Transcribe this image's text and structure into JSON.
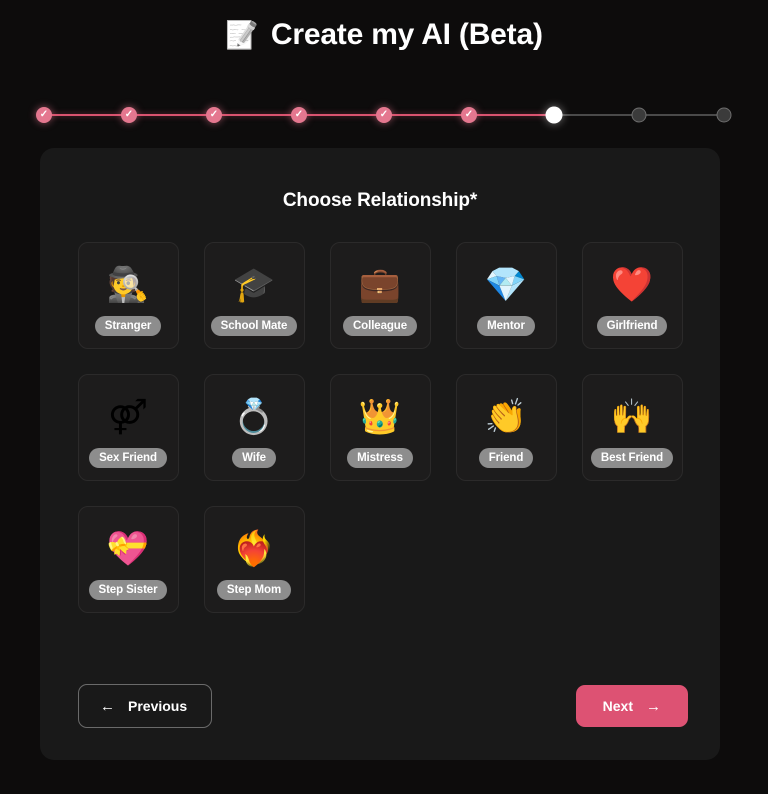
{
  "header": {
    "icon": "pencil-icon",
    "icon_glyph": "📝",
    "title": "Create my AI (Beta)"
  },
  "stepper": {
    "total_steps": 9,
    "completed_steps": 6,
    "current_step": 7,
    "check_glyph": "✓",
    "done_color": "#e4778f",
    "line_done_color": "#d9536f",
    "current_color": "#ffffff",
    "todo_color": "#3b3b3b"
  },
  "main": {
    "heading": "Choose Relationship*",
    "options": [
      {
        "label": "Stranger",
        "icon": "detective-icon",
        "glyph": "🕵"
      },
      {
        "label": "School Mate",
        "icon": "graduation-cap-icon",
        "glyph": "🎓"
      },
      {
        "label": "Colleague",
        "icon": "briefcase-icon",
        "glyph": "💼"
      },
      {
        "label": "Mentor",
        "icon": "books-diamond-icon",
        "glyph": "💎"
      },
      {
        "label": "Girlfriend",
        "icon": "red-heart-icon",
        "glyph": "❤️"
      },
      {
        "label": "Sex Friend",
        "icon": "gender-symbols-icon",
        "glyph": "⚤"
      },
      {
        "label": "Wife",
        "icon": "wedding-rings-icon",
        "glyph": "💍"
      },
      {
        "label": "Mistress",
        "icon": "crown-icon",
        "glyph": "👑"
      },
      {
        "label": "Friend",
        "icon": "clapping-hands-icon",
        "glyph": "👏"
      },
      {
        "label": "Best Friend",
        "icon": "high-five-icon",
        "glyph": "🙌"
      },
      {
        "label": "Step Sister",
        "icon": "heart-locket-icon",
        "glyph": "💝"
      },
      {
        "label": "Step Mom",
        "icon": "heart-on-fire-icon",
        "glyph": "❤️‍🔥"
      }
    ]
  },
  "footer": {
    "previous_label": "Previous",
    "previous_arrow": "←",
    "next_label": "Next",
    "next_arrow": "→",
    "next_color": "#dd5273"
  }
}
